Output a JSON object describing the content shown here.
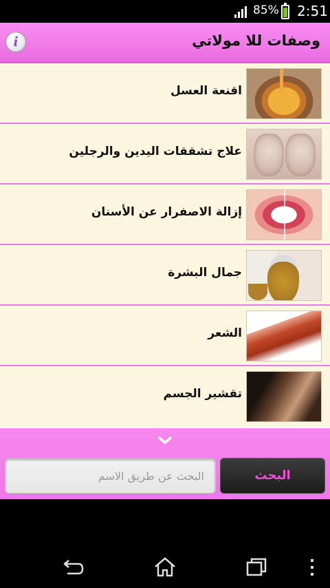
{
  "status_bar": {
    "battery_percent": "85%",
    "time": "2:51",
    "battery_level": 0.85
  },
  "app": {
    "title": "وصفات للا مولاتي",
    "info_icon_glyph": "i"
  },
  "list": {
    "items": [
      {
        "label": "اقنعة العسل",
        "thumbnail": "honey-bowl-image"
      },
      {
        "label": "علاج تشققات اليدين والرجلين",
        "thumbnail": "cracked-heels-image"
      },
      {
        "label": "إزالة الاصفرار عن الأسنان",
        "thumbnail": "teeth-smile-image"
      },
      {
        "label": "جمال البشرة",
        "thumbnail": "face-mask-image"
      },
      {
        "label": "الشعر",
        "thumbnail": "red-hair-image"
      },
      {
        "label": "تقشير الجسم",
        "thumbnail": "body-scrub-image"
      }
    ]
  },
  "search": {
    "placeholder": "البحث عن طريق الاسم",
    "value": "",
    "button_label": "البحث"
  },
  "colors": {
    "accent_pink": "#f07ae8",
    "list_background": "#fcf6e0",
    "search_button_text": "#ee4fd6"
  },
  "nav": {
    "icons": [
      "back-icon",
      "home-icon",
      "recent-apps-icon",
      "overflow-menu-icon"
    ]
  }
}
